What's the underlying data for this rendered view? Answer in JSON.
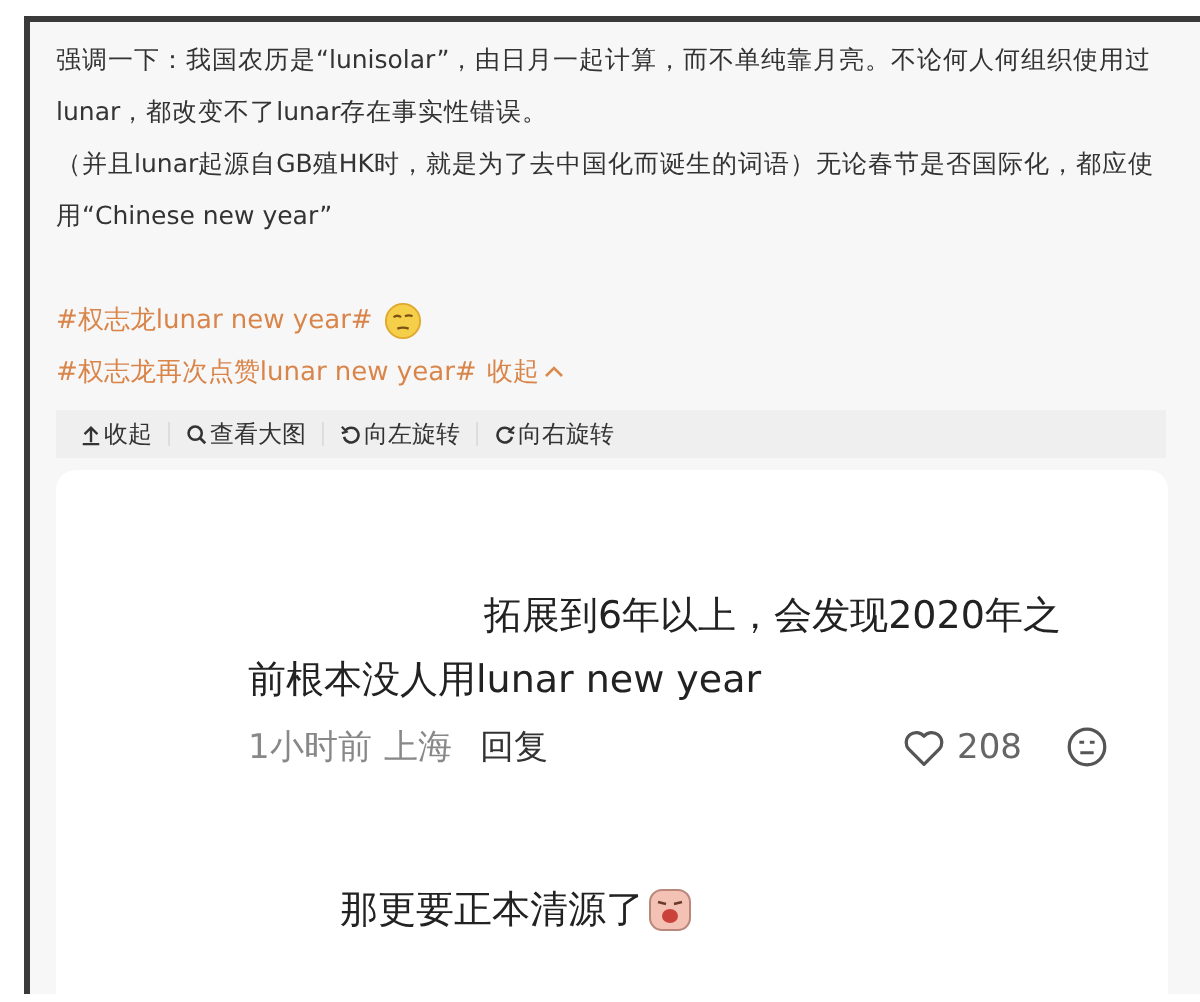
{
  "post": {
    "paragraphs": [
      "强调一下：我国农历是“lunisolar”，由日月一起计算，而不单纯靠月亮。不论何人何组织使用过lunar，都改变不了lunar存在事实性错误。",
      "（并且lunar起源自GB殖HK时，就是为了去中国化而诞生的词语）无论春节是否国际化，都应使用“Chinese new year”"
    ],
    "hashtags": [
      {
        "text": "#权志龙lunar new year#"
      },
      {
        "text": "#权志龙再次点赞lunar new year#",
        "collapse": "收起"
      }
    ]
  },
  "toolbar": [
    {
      "label": "收起"
    },
    {
      "label": "查看大图"
    },
    {
      "label": "向左旋转"
    },
    {
      "label": "向右旋转"
    }
  ],
  "image": {
    "comments": [
      {
        "lines": [
          "拓展到6年以上，会发现2020年之",
          "前根本没人用lunar new year"
        ],
        "time": "1小时前",
        "location": "上海",
        "reply": "回复",
        "likes": "208"
      },
      {
        "lines": [
          "那更要正本清源了"
        ]
      }
    ]
  }
}
